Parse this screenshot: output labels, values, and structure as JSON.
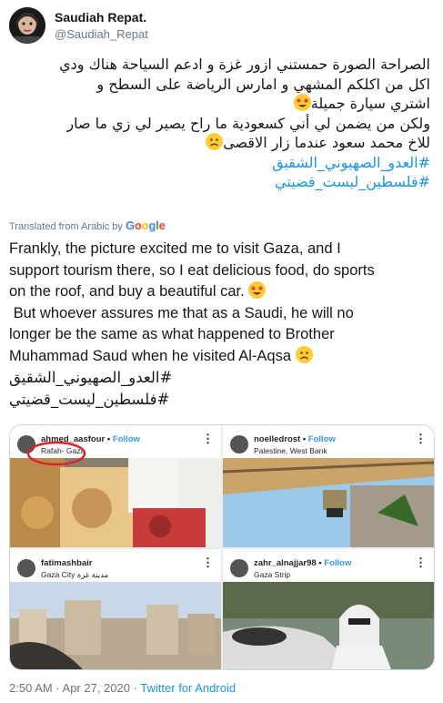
{
  "user": {
    "display_name": "Saudiah Repat.",
    "handle": "@Saudiah_Repat"
  },
  "tweet": {
    "arabic_lines": [
      "الصراحة الصورة حمستني ازور غزة و ادعم السياحة هناك ودي",
      "اكل من اكلكم المشهي و امارس الرياضة على السطح و",
      "اشتري سيارة جميلة",
      "ولكن من يضمن لي أني كسعودية ما راح يصير لي زي ما صار",
      "للاخ محمد سعود عندما زار الاقصى"
    ],
    "arabic_hashtags": [
      "#العدو_الصهيوني_الشقيق",
      "#فلسطين_ليست_قضيتي"
    ],
    "translated_label": "Translated from Arabic by",
    "translator": "Google",
    "english_lines": [
      "Frankly, the picture excited me to visit Gaza, and I",
      "support tourism there, so I eat delicious food, do sports",
      "on the roof, and buy a beautiful car.",
      " But whoever assures me that as a Saudi, he will no",
      "longer be the same as what happened to Brother",
      "Muhammad Saud when he visited Al-Aqsa"
    ],
    "english_hashtags": [
      "العدو_الصهيوني_الشقيق#",
      "فلسطين_ليست_قضيتي#"
    ],
    "emoji": [
      "star-struck-emoji",
      "frowning-face-emoji"
    ]
  },
  "photo_grid": [
    {
      "username": "ahmed_aasfour",
      "follow": "Follow",
      "location": "Rafah- Gaza",
      "content": "food platters"
    },
    {
      "username": "noelledrost",
      "follow": "Follow",
      "location": "Palestine, West Bank",
      "content": "rooftop lamp"
    },
    {
      "username": "fatimashbair",
      "follow": "",
      "location": "Gaza City مدينة غزة",
      "content": "city skyline"
    },
    {
      "username": "zahr_alnajjar98",
      "follow": "Follow",
      "location": "Gaza Strip",
      "content": "woman in convertible car"
    }
  ],
  "footer": {
    "timestamp": "2:50 AM · Apr 27, 2020 · ",
    "source": "Twitter for Android"
  },
  "colors": {
    "link": "#1b95e0",
    "text": "#14171a",
    "muted": "#657786"
  }
}
